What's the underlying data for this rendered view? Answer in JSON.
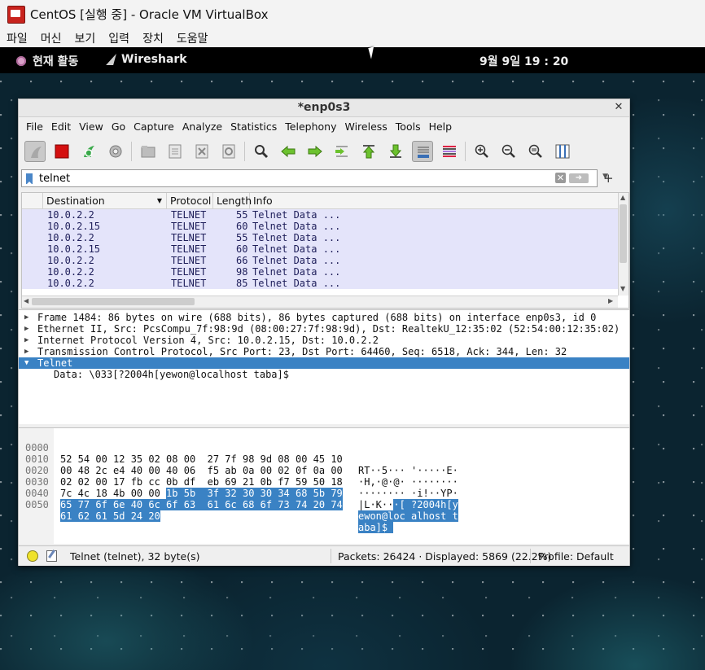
{
  "host": {
    "window_title": "CentOS [실행 중] - Oracle VM VirtualBox",
    "menu": [
      "파일",
      "머신",
      "보기",
      "입력",
      "장치",
      "도움말"
    ]
  },
  "guest_topbar": {
    "activities": "현재 활동",
    "app_name": "Wireshark",
    "clock": "9월 9일  19 : 20"
  },
  "wireshark": {
    "title": "*enp0s3",
    "menu": [
      "File",
      "Edit",
      "View",
      "Go",
      "Capture",
      "Analyze",
      "Statistics",
      "Telephony",
      "Wireless",
      "Tools",
      "Help"
    ],
    "toolbar_icons": [
      "shark-fin-start-icon",
      "stop-capture-icon",
      "restart-capture-icon",
      "capture-options-icon",
      "open-file-icon",
      "save-file-icon",
      "close-file-icon",
      "reload-file-icon",
      "find-packet-icon",
      "go-back-icon",
      "go-forward-icon",
      "go-to-packet-icon",
      "first-packet-icon",
      "last-packet-icon",
      "autoscroll-icon",
      "colorize-icon",
      "zoom-in-icon",
      "zoom-out-icon",
      "zoom-normal-icon",
      "resize-columns-icon"
    ],
    "filter": {
      "value": "telnet"
    },
    "packet_list": {
      "columns": [
        "Destination",
        "Protocol",
        "Length",
        "Info"
      ],
      "rows": [
        {
          "destination": "10.0.2.2",
          "protocol": "TELNET",
          "length": "55",
          "info": "Telnet Data ..."
        },
        {
          "destination": "10.0.2.15",
          "protocol": "TELNET",
          "length": "60",
          "info": "Telnet Data ..."
        },
        {
          "destination": "10.0.2.2",
          "protocol": "TELNET",
          "length": "55",
          "info": "Telnet Data ..."
        },
        {
          "destination": "10.0.2.15",
          "protocol": "TELNET",
          "length": "60",
          "info": "Telnet Data ..."
        },
        {
          "destination": "10.0.2.2",
          "protocol": "TELNET",
          "length": "66",
          "info": "Telnet Data ..."
        },
        {
          "destination": "10.0.2.2",
          "protocol": "TELNET",
          "length": "98",
          "info": "Telnet Data ..."
        },
        {
          "destination": "10.0.2.2",
          "protocol": "TELNET",
          "length": "85",
          "info": "Telnet Data ..."
        }
      ]
    },
    "details": [
      {
        "text": "Frame 1484: 86 bytes on wire (688 bits), 86 bytes captured (688 bits) on interface enp0s3, id 0",
        "expanded": false
      },
      {
        "text": "Ethernet II, Src: PcsCompu_7f:98:9d (08:00:27:7f:98:9d), Dst: RealtekU_12:35:02 (52:54:00:12:35:02)",
        "expanded": false
      },
      {
        "text": "Internet Protocol Version 4, Src: 10.0.2.15, Dst: 10.0.2.2",
        "expanded": false
      },
      {
        "text": "Transmission Control Protocol, Src Port: 23, Dst Port: 64460, Seq: 6518, Ack: 344, Len: 32",
        "expanded": false
      },
      {
        "text": "Telnet",
        "expanded": true,
        "selected": true
      }
    ],
    "details_child": "Data: \\033[?2004h[yewon@localhost taba]$",
    "bytes": [
      {
        "off": "0000",
        "hex_a": "52 54 00 12 35 02 08 00  27 7f 98 9d 08 00 45 10",
        "hex_b": "",
        "asc_a": "RT··5··· '·····E·",
        "asc_b": ""
      },
      {
        "off": "0010",
        "hex_a": "00 48 2c e4 40 00 40 06  f5 ab 0a 00 02 0f 0a 00",
        "hex_b": "",
        "asc_a": "·H,·@·@· ········",
        "asc_b": ""
      },
      {
        "off": "0020",
        "hex_a": "02 02 00 17 fb cc 0b df  eb 69 21 0b f7 59 50 18",
        "hex_b": "",
        "asc_a": "········ ·i!··YP·",
        "asc_b": ""
      },
      {
        "off": "0030",
        "hex_a": "7c 4c 18 4b 00 00 ",
        "hex_b": "1b 5b  3f 32 30 30 34 68 5b 79",
        "asc_a": "|L·K··",
        "asc_b": "·[ ?2004h[y"
      },
      {
        "off": "0040",
        "hex_a": "",
        "hex_b": "65 77 6f 6e 40 6c 6f 63  61 6c 68 6f 73 74 20 74",
        "asc_a": "",
        "asc_b": "ewon@loc alhost t"
      },
      {
        "off": "0050",
        "hex_a": "",
        "hex_b": "61 62 61 5d 24 20",
        "asc_a": "",
        "asc_b": "aba]$ "
      }
    ],
    "status": {
      "field": "Telnet (telnet), 32 byte(s)",
      "packets": "Packets: 26424 · Displayed: 5869 (22.2%)",
      "profile": "Profile: Default"
    }
  }
}
